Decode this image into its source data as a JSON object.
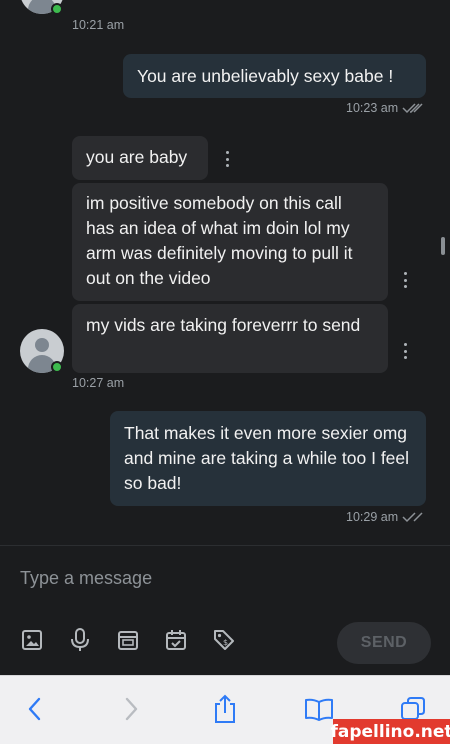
{
  "messages": [
    {
      "time": "10:21 am"
    },
    {
      "text": "You are unbelievably sexy babe !",
      "time": "10:23 am"
    },
    {
      "text": "you are baby"
    },
    {
      "text": "im positive somebody on this call has an idea of what im doin lol my arm was definitely moving to pull it out on the video"
    },
    {
      "text": "my vids are taking foreverrr to send",
      "time": "10:27 am"
    },
    {
      "text": "That makes it even more sexier omg and mine are taking a while too I feel so bad!",
      "time": "10:29 am"
    }
  ],
  "composer": {
    "placeholder": "Type a message",
    "send_label": "SEND",
    "tools": [
      "image-icon",
      "microphone-icon",
      "archive-icon",
      "calendar-check-icon",
      "price-tag-icon"
    ]
  },
  "browser_toolbar": {
    "icons": [
      "back-icon",
      "forward-icon",
      "share-icon",
      "bookmarks-icon",
      "tabs-icon"
    ]
  },
  "watermark": "fapellino.net",
  "colors": {
    "background": "#1b1c1e",
    "incoming_bubble": "#2b2c2f",
    "outgoing_bubble": "#26313a",
    "online": "#3dbb4e",
    "safari_accent": "#2f7bf6",
    "watermark_bg": "#e23a2e"
  }
}
